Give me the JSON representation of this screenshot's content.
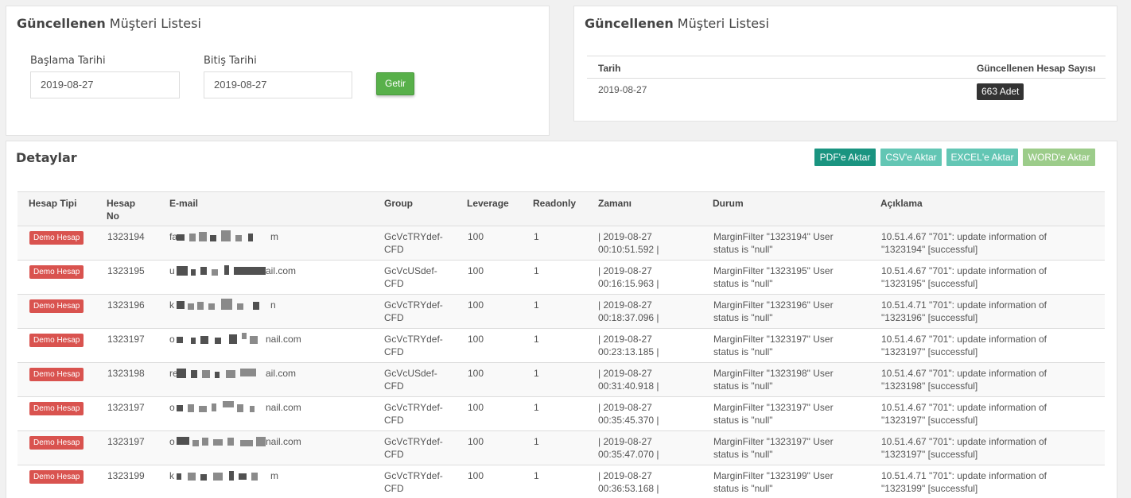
{
  "filter_panel": {
    "title_bold": "Güncellenen",
    "title_rest": " Müşteri Listesi",
    "start_label": "Başlama Tarihi",
    "start_value": "2019-08-27",
    "end_label": "Bitiş Tarihi",
    "end_value": "2019-08-27",
    "submit_label": "Getir"
  },
  "summary_panel": {
    "title_bold": "Güncellenen",
    "title_rest": " Müşteri Listesi",
    "col_date": "Tarih",
    "col_count": "Güncellenen Hesap Sayısı",
    "date": "2019-08-27",
    "count": "663 Adet"
  },
  "details": {
    "title": "Detaylar",
    "export_pdf": "PDF'e Aktar",
    "export_csv": "CSV'e Aktar",
    "export_excel": "EXCEL'e Aktar",
    "export_word": "WORD'e Aktar",
    "colors": {
      "pdf": "#1a9480",
      "csv": "#63c6b4",
      "excel": "#63c6b4",
      "word": "#9ccc8a",
      "demo": "#d9534f"
    },
    "headers": {
      "hesap_tipi": "Hesap Tipi",
      "hesap_no_1": "Hesap",
      "hesap_no_2": "No",
      "email": "E-mail",
      "group": "Group",
      "leverage": "Leverage",
      "readonly": "Readonly",
      "zamani": "Zamanı",
      "durum": "Durum",
      "aciklama": "Açıklama"
    },
    "rows": [
      {
        "type": "Demo Hesap",
        "no": "1323194",
        "email_start": "fa",
        "email_end": "m",
        "group1": "GcVcTRYdef-",
        "group2": "CFD",
        "leverage": "100",
        "readonly": "1",
        "time1": "| 2019-08-27",
        "time2": "00:10:51.592 |",
        "durum1": "MarginFilter \"1323194\" User",
        "durum2": "status is \"null\"",
        "acik1": "10.51.4.67 \"701\": update information of",
        "acik2": "\"1323194\" [successful]"
      },
      {
        "type": "Demo Hesap",
        "no": "1323195",
        "email_start": "u",
        "email_end": "ail.com",
        "group1": "GcVcUSdef-",
        "group2": "CFD",
        "leverage": "100",
        "readonly": "1",
        "time1": "| 2019-08-27",
        "time2": "00:16:15.963 |",
        "durum1": "MarginFilter \"1323195\" User",
        "durum2": "status is \"null\"",
        "acik1": "10.51.4.67 \"701\": update information of",
        "acik2": "\"1323195\" [successful]"
      },
      {
        "type": "Demo Hesap",
        "no": "1323196",
        "email_start": "k",
        "email_end": "n",
        "group1": "GcVcTRYdef-",
        "group2": "CFD",
        "leverage": "100",
        "readonly": "1",
        "time1": "| 2019-08-27",
        "time2": "00:18:37.096 |",
        "durum1": "MarginFilter \"1323196\" User",
        "durum2": "status is \"null\"",
        "acik1": "10.51.4.71 \"701\": update information of",
        "acik2": "\"1323196\" [successful]"
      },
      {
        "type": "Demo Hesap",
        "no": "1323197",
        "email_start": "o",
        "email_end": "nail.com",
        "group1": "GcVcTRYdef-",
        "group2": "CFD",
        "leverage": "100",
        "readonly": "1",
        "time1": "| 2019-08-27",
        "time2": "00:23:13.185 |",
        "durum1": "MarginFilter \"1323197\" User",
        "durum2": "status is \"null\"",
        "acik1": "10.51.4.67 \"701\": update information of",
        "acik2": "\"1323197\" [successful]"
      },
      {
        "type": "Demo Hesap",
        "no": "1323198",
        "email_start": "re",
        "email_end": "ail.com",
        "group1": "GcVcUSdef-",
        "group2": "CFD",
        "leverage": "100",
        "readonly": "1",
        "time1": "| 2019-08-27",
        "time2": "00:31:40.918 |",
        "durum1": "MarginFilter \"1323198\" User",
        "durum2": "status is \"null\"",
        "acik1": "10.51.4.67 \"701\": update information of",
        "acik2": "\"1323198\" [successful]"
      },
      {
        "type": "Demo Hesap",
        "no": "1323197",
        "email_start": "o",
        "email_end": "nail.com",
        "group1": "GcVcTRYdef-",
        "group2": "CFD",
        "leverage": "100",
        "readonly": "1",
        "time1": "| 2019-08-27",
        "time2": "00:35:45.370 |",
        "durum1": "MarginFilter \"1323197\" User",
        "durum2": "status is \"null\"",
        "acik1": "10.51.4.67 \"701\": update information of",
        "acik2": "\"1323197\" [successful]"
      },
      {
        "type": "Demo Hesap",
        "no": "1323197",
        "email_start": "o",
        "email_end": "nail.com",
        "group1": "GcVcTRYdef-",
        "group2": "CFD",
        "leverage": "100",
        "readonly": "1",
        "time1": "| 2019-08-27",
        "time2": "00:35:47.070 |",
        "durum1": "MarginFilter \"1323197\" User",
        "durum2": "status is \"null\"",
        "acik1": "10.51.4.67 \"701\": update information of",
        "acik2": "\"1323197\" [successful]"
      },
      {
        "type": "Demo Hesap",
        "no": "1323199",
        "email_start": "k",
        "email_end": "m",
        "group1": "GcVcTRYdef-",
        "group2": "CFD",
        "leverage": "100",
        "readonly": "1",
        "time1": "| 2019-08-27",
        "time2": "00:36:53.168 |",
        "durum1": "MarginFilter \"1323199\" User",
        "durum2": "status is \"null\"",
        "acik1": "10.51.4.71 \"701\": update information of",
        "acik2": "\"1323199\" [successful]"
      }
    ]
  }
}
